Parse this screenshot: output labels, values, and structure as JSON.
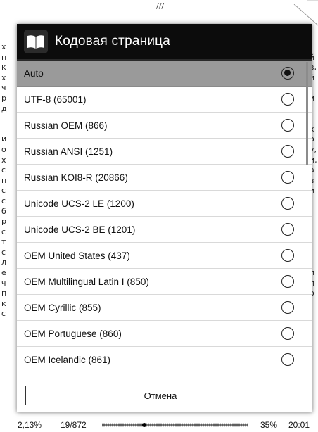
{
  "background": {
    "top_mark": "///",
    "left_letters": [
      "х",
      "п",
      "к",
      "х",
      "ч",
      "р",
      "д",
      "",
      "",
      "и",
      "о",
      "х",
      "с",
      "п",
      "с",
      "с",
      "б",
      "р",
      "с",
      "т",
      "с",
      "л",
      "е",
      "ч",
      "п",
      "к",
      "с"
    ],
    "right_letters": [
      "-",
      "й",
      "в,",
      "й",
      "-",
      "и",
      "",
      "",
      "х",
      "о",
      "у,",
      "и,",
      "а",
      "в",
      "и",
      "-",
      "-",
      "-",
      "-",
      "-",
      "-",
      "-",
      "л",
      "л",
      "о",
      "-",
      ""
    ]
  },
  "dialog": {
    "title": "Кодовая страница",
    "icon": "book-icon",
    "items": [
      {
        "label": "Auto",
        "selected": true
      },
      {
        "label": "UTF-8 (65001)",
        "selected": false
      },
      {
        "label": "Russian OEM (866)",
        "selected": false
      },
      {
        "label": "Russian ANSI (1251)",
        "selected": false
      },
      {
        "label": "Russian KOI8-R (20866)",
        "selected": false
      },
      {
        "label": "Unicode UCS-2 LE (1200)",
        "selected": false
      },
      {
        "label": "Unicode UCS-2 BE (1201)",
        "selected": false
      },
      {
        "label": "OEM United States (437)",
        "selected": false
      },
      {
        "label": "OEM Multilingual Latin I (850)",
        "selected": false
      },
      {
        "label": "OEM Cyrillic (855)",
        "selected": false
      },
      {
        "label": "OEM Portuguese (860)",
        "selected": false
      },
      {
        "label": "OEM Icelandic (861)",
        "selected": false
      }
    ],
    "cancel_label": "Отмена"
  },
  "status": {
    "percent": "2,13%",
    "pages": "19/872",
    "reading_progress": 0.0213,
    "battery": "35%",
    "clock": "20:01"
  },
  "colors": {
    "header_bg": "#0c0c0c",
    "selected_bg": "#9a9a9a"
  }
}
